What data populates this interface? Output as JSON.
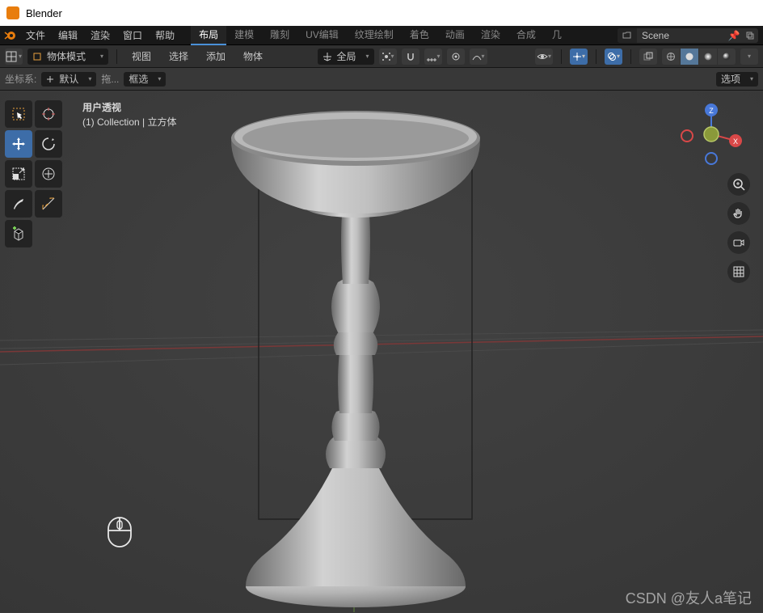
{
  "window": {
    "title": "Blender"
  },
  "topmenu": [
    "文件",
    "编辑",
    "渲染",
    "窗口",
    "帮助"
  ],
  "workspaces": {
    "items": [
      "布局",
      "建模",
      "雕刻",
      "UV编辑",
      "纹理绘制",
      "着色",
      "动画",
      "渲染",
      "合成",
      "几"
    ],
    "active": 0
  },
  "scene": {
    "name": "Scene"
  },
  "header2": {
    "mode": "物体模式",
    "menus": [
      "视图",
      "选择",
      "添加",
      "物体"
    ],
    "orientation": "全局"
  },
  "header3": {
    "coord_label": "坐标系:",
    "coord_value": "默认",
    "drag_label": "拖...",
    "box_select": "框选",
    "options": "选项"
  },
  "overlay": {
    "line1": "用户透视",
    "line2": "(1) Collection | 立方体"
  },
  "gizmo_axes": {
    "x": "X",
    "z": "Z"
  },
  "watermark": "CSDN @友人a笔记"
}
